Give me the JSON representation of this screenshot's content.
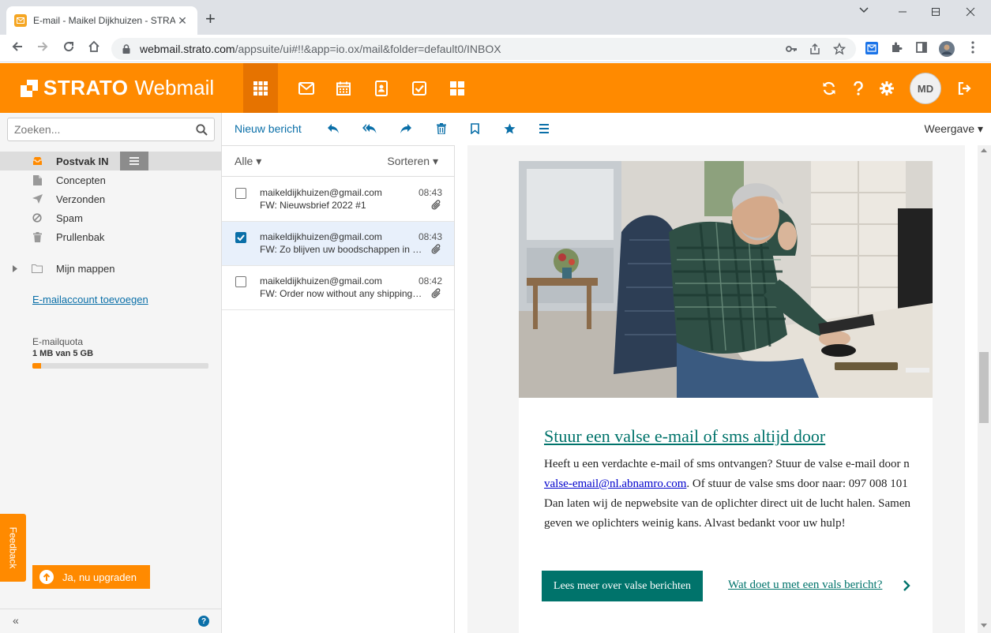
{
  "browser": {
    "tab_title": "E-mail - Maikel Dijkhuizen - STRATO",
    "tab_close": "✕",
    "new_tab": "+",
    "url_host": "webmail.strato.com",
    "url_path": "/appsuite/ui#!!&app=io.ox/mail&folder=default0/INBOX"
  },
  "app": {
    "brand": "STRATO",
    "product": "Webmail",
    "avatar_initials": "MD",
    "accent_color": "#ff8a00",
    "link_color": "#0a6fa8"
  },
  "sidebar": {
    "search_placeholder": "Zoeken...",
    "folders": [
      {
        "label": "Postvak IN",
        "icon": "inbox-icon"
      },
      {
        "label": "Concepten",
        "icon": "file-icon"
      },
      {
        "label": "Verzonden",
        "icon": "send-icon"
      },
      {
        "label": "Spam",
        "icon": "block-icon"
      },
      {
        "label": "Prullenbak",
        "icon": "trash-icon"
      }
    ],
    "my_folders": "Mijn mappen",
    "add_account": "E-mailaccount toevoegen",
    "quota_title": "E-mailquota",
    "quota_value": "1 MB van 5 GB",
    "quota_percent": 5,
    "feedback": "Feedback",
    "upgrade": "Ja, nu upgraden",
    "collapse": "«",
    "help": "?"
  },
  "toolbar": {
    "new_message": "Nieuw bericht",
    "view": "Weergave ▾"
  },
  "list": {
    "filter": "Alle ▾",
    "sort": "Sorteren ▾",
    "mails": [
      {
        "from": "maikeldijkhuizen@gmail.com",
        "subject": "FW: Nieuwsbrief 2022 #1",
        "time": "08:43",
        "checked": false
      },
      {
        "from": "maikeldijkhuizen@gmail.com",
        "subject": "FW: Zo blijven uw boodschappen in veilig",
        "time": "08:43",
        "checked": true
      },
      {
        "from": "maikeldijkhuizen@gmail.com",
        "subject": "FW: Order now without any shipping costs",
        "time": "08:42",
        "checked": false
      }
    ]
  },
  "message": {
    "headline": "Stuur een valse e-mail of sms altijd door",
    "para_line1": "Heeft u een verdachte e-mail of sms ontvangen? Stuur de valse e-mail door n",
    "para_email": "valse-email@nl.abnamro.com",
    "para_line2_rest": ". Of stuur de valse sms door naar: 097 008 101",
    "para_line3": "Dan laten wij de nepwebsite van de oplichter direct uit de lucht halen. Samen",
    "para_line4": "geven we oplichters weinig kans. Alvast bedankt voor uw hulp!",
    "cta_button": "Lees meer over valse berichten",
    "cta_link": "Wat doet u met een vals bericht?"
  }
}
